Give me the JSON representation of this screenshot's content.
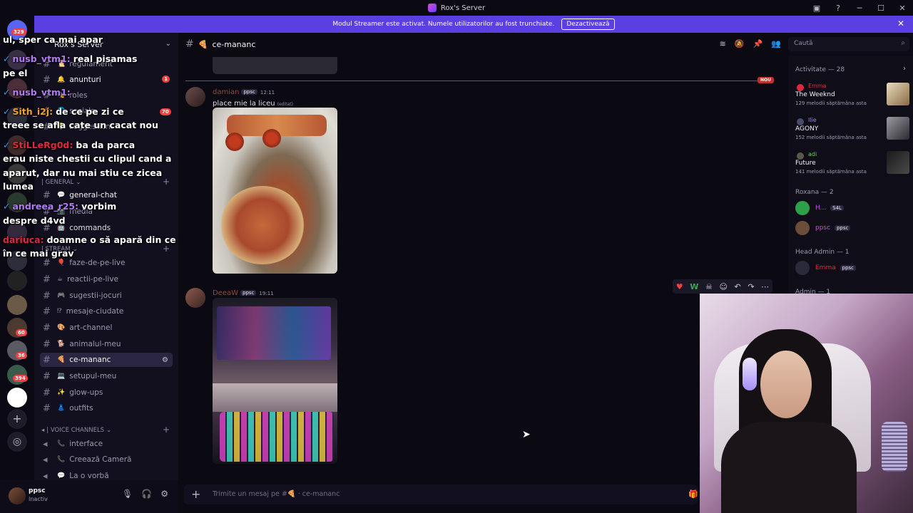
{
  "window": {
    "title": "Rox's Server"
  },
  "banner": {
    "text": "Modul Streamer este activat. Numele utilizatorilor au fost trunchiate.",
    "button": "Dezactivează"
  },
  "server_badges": {
    "top": "329",
    "b1": "60",
    "b2": "36",
    "b3": "394"
  },
  "sidebar": {
    "server_name": "Rox's Server",
    "channels_top": [
      {
        "label": "regulament",
        "emoji": "📜"
      },
      {
        "label": "anunturi",
        "emoji": "🔔",
        "badge": "1"
      },
      {
        "label": "roles",
        "emoji": "🎭"
      },
      {
        "label": "socials",
        "emoji": "🌐"
      },
      {
        "label": "suggestions",
        "emoji": "💡"
      }
    ],
    "cat_general": "| GENERAL",
    "channels_general": [
      {
        "label": "general-chat",
        "emoji": "💬"
      },
      {
        "label": "media",
        "emoji": "📷"
      },
      {
        "label": "commands",
        "emoji": "🤖"
      }
    ],
    "cat_stream": "| STREAM",
    "channels_stream": [
      {
        "label": "faze-de-pe-live",
        "emoji": "🎈"
      },
      {
        "label": "reactii-pe-live",
        "emoji": "☕"
      },
      {
        "label": "sugestii-jocuri",
        "emoji": "🎮"
      },
      {
        "label": "mesaje-ciudate",
        "emoji": "⁉"
      },
      {
        "label": "art-channel",
        "emoji": "🎨"
      },
      {
        "label": "animalul-meu",
        "emoji": "🐕"
      },
      {
        "label": "ce-mananc",
        "emoji": "🍕"
      },
      {
        "label": "setupul-meu",
        "emoji": "💻"
      },
      {
        "label": "glow-ups",
        "emoji": "✨"
      },
      {
        "label": "outfits",
        "emoji": "👗"
      }
    ],
    "cat_voice": "| VOICE CHANNELS",
    "voice": [
      {
        "label": "interface",
        "emoji": "📞"
      },
      {
        "label": "Creează Cameră",
        "emoji": "📞"
      },
      {
        "label": "La o vorbă",
        "emoji": "💬"
      }
    ]
  },
  "user_panel": {
    "name": "ppsc",
    "status": "Inactiv"
  },
  "channel": {
    "name": "ce-mananc",
    "emoji": "🍕"
  },
  "search": {
    "placeholder": "Caută"
  },
  "new_tag": "NOU",
  "messages": [
    {
      "author": "damian",
      "tag": "ppsc",
      "time": "12:11",
      "text": "place mie la liceu",
      "edited": "(editat)",
      "color": "#8f4a3f"
    },
    {
      "author": "DeeaW",
      "tag": "ppsc",
      "time": "19:11",
      "color": "#8f4a3f"
    }
  ],
  "composer": {
    "placeholder": "Trimite un mesaj pe #🍕 · ce-mananc"
  },
  "members": {
    "activity_header": "Activitate — 28",
    "activities": [
      {
        "name": "Emma",
        "title": "The Weeknd",
        "sub": "129 melodii săptămâna asta",
        "color": "#e0283c"
      },
      {
        "name": "Ilie",
        "title": "AGONY",
        "sub": "152 melodii săptămâna asta",
        "color": "#8f8fe0"
      },
      {
        "name": "adi",
        "title": "Future",
        "sub": "141 melodii săptămâna asta",
        "color": "#6ad15b"
      }
    ],
    "roxana_header": "Roxana — 2",
    "roxana": [
      {
        "name": "H...",
        "tag": "S4L",
        "color": "#c050e0"
      },
      {
        "name": "ppsc",
        "tag": "ppsc",
        "color": "#c050e0"
      }
    ],
    "head_admin_header": "Head Admin — 1",
    "head_admin": [
      {
        "name": "Emma",
        "tag": "ppsc",
        "color": "#e0283c"
      }
    ],
    "admin_header": "Admin — 1"
  },
  "chat_overlay": [
    {
      "text": "ul, sper ca mai apar"
    },
    {
      "user": "nusb_vtm1:",
      "text": "real pisamas",
      "color": "#b07cf0"
    },
    {
      "text": "pe el"
    },
    {
      "user": "nusb_vtm1:",
      "text": "",
      "color": "#b07cf0"
    },
    {
      "user": "Sith_i2j:",
      "text": "de ce pe zi ce",
      "color": "#f0a030"
    },
    {
      "text": "treee se afla cate un cacat nou"
    },
    {
      "user": "StiLLeRg0d:",
      "text": "ba da parca",
      "color": "#e0283c"
    },
    {
      "text": "erau niste chestii cu clipul cand a"
    },
    {
      "text": "aparut, dar nu mai stiu ce zicea"
    },
    {
      "text": "lumea"
    },
    {
      "user": "andreea_r25:",
      "text": "vorbim",
      "color": "#b07cf0"
    },
    {
      "text": "despre d4vd"
    },
    {
      "user": "dariuca:",
      "text": "doamne o să apară din ce",
      "color": "#e0283c"
    },
    {
      "text": "în ce mai grav"
    }
  ],
  "chat_badge": "70"
}
